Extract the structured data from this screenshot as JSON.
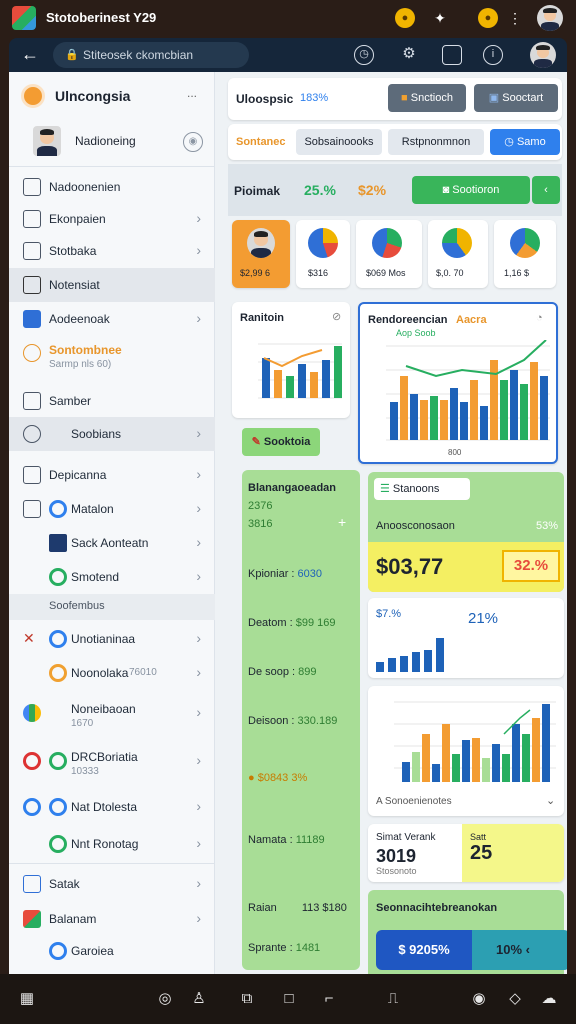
{
  "status_bar": {
    "title": "Stotoberinest Y29"
  },
  "browser": {
    "url": "Stiteosek ckomcbian"
  },
  "sidebar": {
    "header": "Ulncongsia",
    "header_menu": "...",
    "profile_name": "Nadioneing",
    "items": [
      {
        "label": "Nadoonenien"
      },
      {
        "label": "Ekonpaien"
      },
      {
        "label": "Stotbaka"
      },
      {
        "label": "Notensiat"
      },
      {
        "label": "Aodeenoak"
      },
      {
        "label": "Sontombnee"
      },
      {
        "label": "Samber"
      },
      {
        "label": "Soobians"
      },
      {
        "label": "Depicanna"
      },
      {
        "label": "Matalon"
      },
      {
        "label": "Sack Aonteatn"
      },
      {
        "label": "Smotend"
      },
      {
        "label": "Soofembus"
      },
      {
        "label": "Unotianinaa"
      },
      {
        "label": "Noonolaka"
      },
      {
        "label": "Noneibaoan"
      },
      {
        "label": "DRCBoriatia"
      },
      {
        "label": "Nat Dtolesta"
      },
      {
        "label": "Nnt Ronotag"
      },
      {
        "label": "Satak"
      },
      {
        "label": "Balanam"
      },
      {
        "label": "Garoiea"
      }
    ],
    "sub_texts": {
      "sontombnee": "Sarmp nls 60)",
      "noonolaka": "76010",
      "noneibaoan": "1670",
      "drcboriatia": "10333"
    }
  },
  "main": {
    "header_title": "Uloospsic",
    "header_pct": "183%",
    "btn_a": "Snctioch",
    "btn_b": "Sooctart",
    "tab1": "Sontanec",
    "tab2": "Sobsainoooks",
    "tab3": "Rstpnonmnon",
    "tab4": "Samo",
    "kpi_label": "Pioimak",
    "kpi_val1": "25.%",
    "kpi_val2": "$2%",
    "kpi_btn": "Sootioron",
    "tiles": [
      {
        "label": "$2,99 6"
      },
      {
        "label": "$316"
      },
      {
        "label": "$069 Mos"
      },
      {
        "label": "$,0. 70"
      },
      {
        "label": "1,16 $"
      }
    ],
    "chart1_title": "Ranitoin",
    "chart2_title": "Rendoreencian",
    "chart2_tag": "Aacra",
    "chart2_sub": "Aop Soob",
    "chart2_xlabel": "800",
    "green_btn": "Sooktoia",
    "left_panel_title": "Blanangaoeadan",
    "left_panel_pct": "2376",
    "left_panel_sub": "3816",
    "lp_rows": [
      {
        "k": "Kpioniar :",
        "v": "6030"
      },
      {
        "k": "Deatom :",
        "v": "$99 169"
      },
      {
        "k": "De soop :",
        "v": "899"
      },
      {
        "k": "Deisoon :",
        "v": "330.189"
      },
      {
        "k": "$0843 3%",
        "v": ""
      },
      {
        "k": "Namata :",
        "v": "11189"
      },
      {
        "k": "Raian",
        "v": "113 $180"
      },
      {
        "k": "Sprante :",
        "v": "1481"
      }
    ],
    "right_btn": "Stanoons",
    "right_sub": "Anoosconosaon",
    "right_sub_pct": "53%",
    "big_value": "$03,77",
    "big_pct": "32.%",
    "mini_val": "$7.%",
    "mini_pct": "21%",
    "chart3_caption": "A Sonoenienotes",
    "stat_label": "Simat Verank",
    "stat_sub": "Stosonoto",
    "stat_val": "3019",
    "stat_side_label": "Satt",
    "stat_side_val": "25",
    "bottom_title": "Seonnacihtebreanokan",
    "bottom_left": "$ 9205%",
    "bottom_right": "10%"
  }
}
